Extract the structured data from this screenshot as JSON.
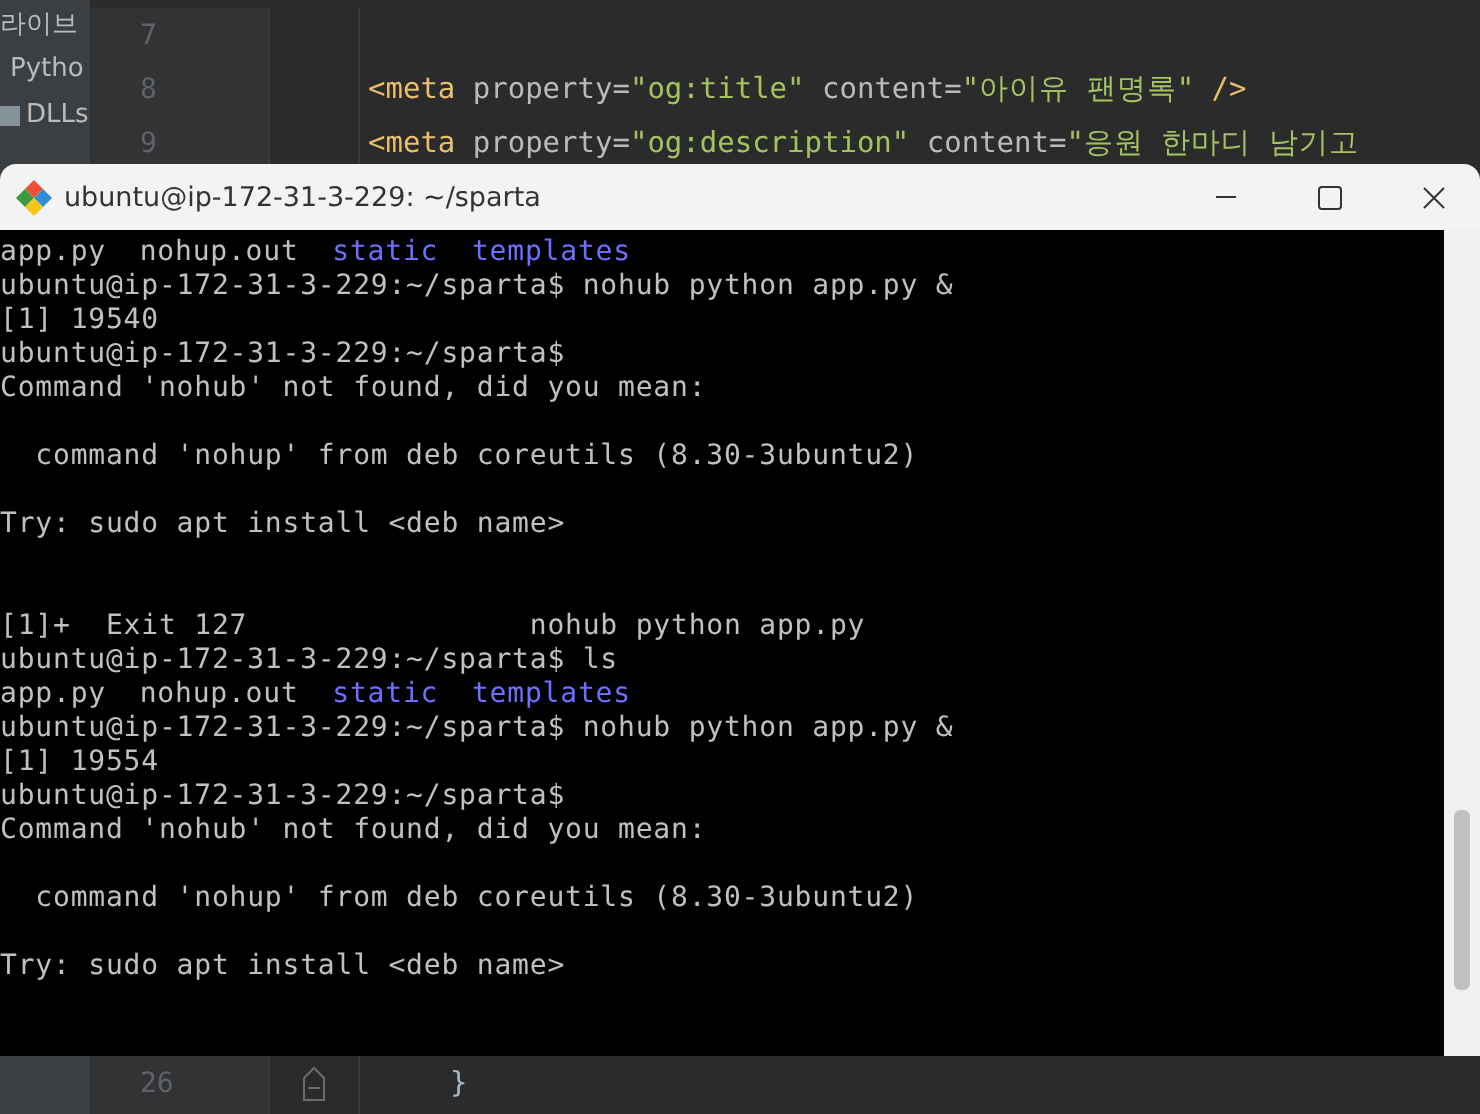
{
  "project_tree": {
    "items": [
      {
        "label": "라이브",
        "kind": "text"
      },
      {
        "label": "Pytho",
        "kind": "text"
      },
      {
        "label": "DLLs",
        "kind": "folder"
      }
    ]
  },
  "editor": {
    "lines": [
      {
        "number": "7"
      },
      {
        "number": "8",
        "tokens": [
          {
            "text": "<meta",
            "kind": "tag"
          },
          {
            "text": " property=",
            "kind": "attr"
          },
          {
            "text": "\"og:title\"",
            "kind": "value"
          },
          {
            "text": " content=",
            "kind": "attr"
          },
          {
            "text": "\"아이유 팬명록\"",
            "kind": "value"
          },
          {
            "text": " />",
            "kind": "tag"
          }
        ]
      },
      {
        "number": "9",
        "tokens": [
          {
            "text": "<meta",
            "kind": "tag"
          },
          {
            "text": " property=",
            "kind": "attr"
          },
          {
            "text": "\"og:description\"",
            "kind": "value"
          },
          {
            "text": " content=",
            "kind": "attr"
          },
          {
            "text": "\"응원 한마디 남기고",
            "kind": "value"
          }
        ]
      }
    ],
    "bottom_line": {
      "number": "26",
      "tokens": [
        {
          "text": "}",
          "kind": "brace"
        }
      ]
    }
  },
  "terminal": {
    "title": "ubuntu@ip-172-31-3-229: ~/sparta",
    "lines": [
      {
        "kind": "listing",
        "entries": [
          {
            "text": "app.py",
            "kind": "file"
          },
          {
            "text": "nohup.out",
            "kind": "file"
          },
          {
            "text": "static",
            "kind": "directory"
          },
          {
            "text": "templates",
            "kind": "directory"
          }
        ]
      },
      {
        "kind": "text",
        "text": "ubuntu@ip-172-31-3-229:~/sparta$ nohub python app.py &"
      },
      {
        "kind": "text",
        "text": "[1] 19540"
      },
      {
        "kind": "text",
        "text": "ubuntu@ip-172-31-3-229:~/sparta$"
      },
      {
        "kind": "text",
        "text": "Command 'nohub' not found, did you mean:"
      },
      {
        "kind": "blank"
      },
      {
        "kind": "text",
        "text": "  command 'nohup' from deb coreutils (8.30-3ubuntu2)"
      },
      {
        "kind": "blank"
      },
      {
        "kind": "text",
        "text": "Try: sudo apt install <deb name>"
      },
      {
        "kind": "blank"
      },
      {
        "kind": "blank"
      },
      {
        "kind": "text",
        "text": "[1]+  Exit 127                nohub python app.py"
      },
      {
        "kind": "text",
        "text": "ubuntu@ip-172-31-3-229:~/sparta$ ls"
      },
      {
        "kind": "listing",
        "entries": [
          {
            "text": "app.py",
            "kind": "file"
          },
          {
            "text": "nohup.out",
            "kind": "file"
          },
          {
            "text": "static",
            "kind": "directory"
          },
          {
            "text": "templates",
            "kind": "directory"
          }
        ]
      },
      {
        "kind": "text",
        "text": "ubuntu@ip-172-31-3-229:~/sparta$ nohub python app.py &"
      },
      {
        "kind": "text",
        "text": "[1] 19554"
      },
      {
        "kind": "text",
        "text": "ubuntu@ip-172-31-3-229:~/sparta$"
      },
      {
        "kind": "text",
        "text": "Command 'nohub' not found, did you mean:"
      },
      {
        "kind": "blank"
      },
      {
        "kind": "text",
        "text": "  command 'nohup' from deb coreutils (8.30-3ubuntu2)"
      },
      {
        "kind": "blank"
      },
      {
        "kind": "text",
        "text": "Try: sudo apt install <deb name>"
      }
    ]
  }
}
